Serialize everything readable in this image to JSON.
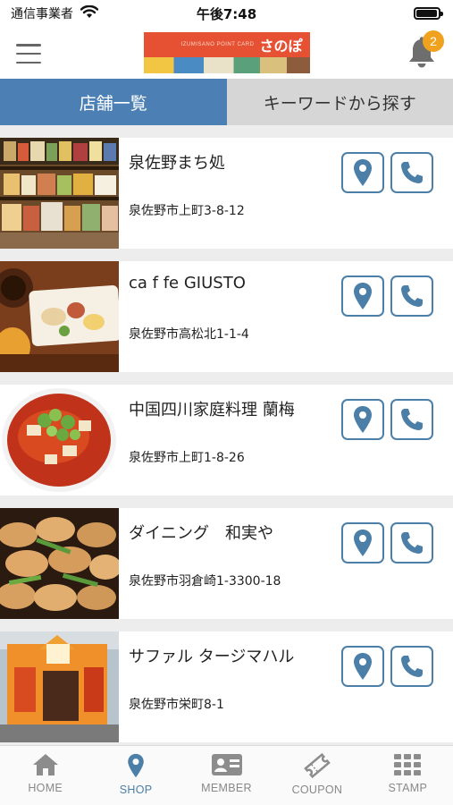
{
  "status_bar": {
    "carrier": "通信事業者",
    "time": "午後7:48",
    "battery_level": 0.95
  },
  "header": {
    "logo_small_text": "IZUMISANO POINT CARD",
    "logo_text": "さのぽ",
    "notification_count": "2",
    "menu_icon": "hamburger-icon",
    "bell_icon": "bell-icon"
  },
  "tabs": [
    {
      "label": "店舗一覧",
      "active": true
    },
    {
      "label": "キーワードから探す",
      "active": false
    }
  ],
  "shops": [
    {
      "name": "泉佐野まち処",
      "address": "泉佐野市上町3-8-12"
    },
    {
      "name": "ca f fe GIUSTO",
      "address": "泉佐野市高松北1-1-4"
    },
    {
      "name": "中国四川家庭料理 蘭梅",
      "address": "泉佐野市上町1-8-26"
    },
    {
      "name": "ダイニング　和実や",
      "address": "泉佐野市羽倉崎1-3300-18"
    },
    {
      "name": "サファル タージマハル",
      "address": "泉佐野市栄町8-1"
    }
  ],
  "bottom_nav": [
    {
      "label": "HOME",
      "icon": "home-icon",
      "active": false
    },
    {
      "label": "SHOP",
      "icon": "map-pin-icon",
      "active": true
    },
    {
      "label": "MEMBER",
      "icon": "member-card-icon",
      "active": false
    },
    {
      "label": "COUPON",
      "icon": "ticket-icon",
      "active": false
    },
    {
      "label": "STAMP",
      "icon": "grid-icon",
      "active": false
    }
  ],
  "colors": {
    "accent": "#4c80b4",
    "button_border": "#4b7fa8",
    "badge": "#f0a21f",
    "tab_inactive": "#d6d6d6"
  }
}
